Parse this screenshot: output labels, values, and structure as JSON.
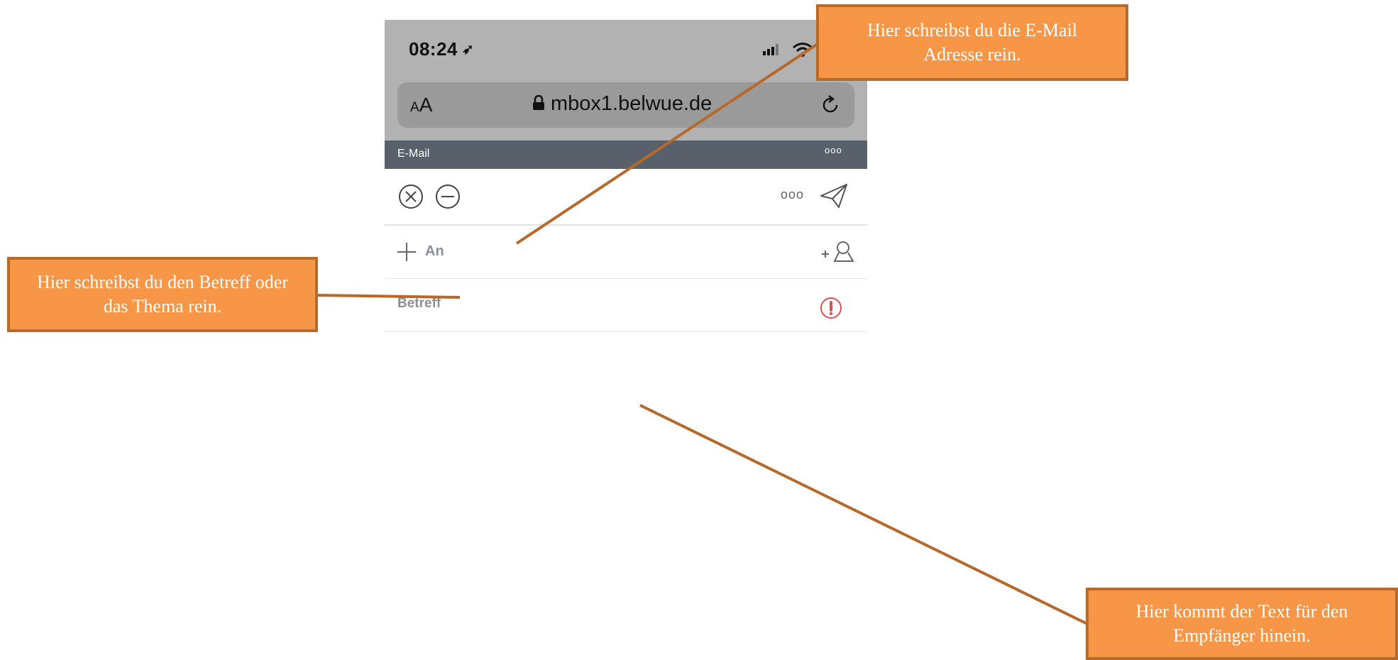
{
  "status_bar": {
    "time": "08:24",
    "location_icon": "location-arrow-icon",
    "signal_icon": "signal-icon",
    "wifi_icon": "wifi-icon"
  },
  "browser": {
    "text_size_small": "A",
    "text_size_big": "A",
    "url": "mbox1.belwue.de",
    "lock_icon": "lock-icon",
    "reload_icon": "reload-icon"
  },
  "app_bar": {
    "title": "E-Mail",
    "more": "ooo"
  },
  "compose_toolbar": {
    "close_icon": "close-circle-icon",
    "minimize_icon": "minus-circle-icon",
    "more": "ooo",
    "send_icon": "paper-plane-icon"
  },
  "fields": {
    "to_label": "An",
    "subject_label": "Betreff",
    "add_contact_icon": "add-contact-icon",
    "priority_icon": "priority-icon"
  },
  "callouts": {
    "email_address": "Hier schreibst du die E-Mail Adresse rein.",
    "subject": "Hier schreibst du den Betreff oder das Thema rein.",
    "body": "Hier kommt der Text für den Empfänger hinein."
  },
  "colors": {
    "callout_fill": "#f79646",
    "callout_border": "#b66a2c",
    "connector": "#b5692a",
    "app_bar": "#58616b",
    "priority": "#d9534f"
  }
}
